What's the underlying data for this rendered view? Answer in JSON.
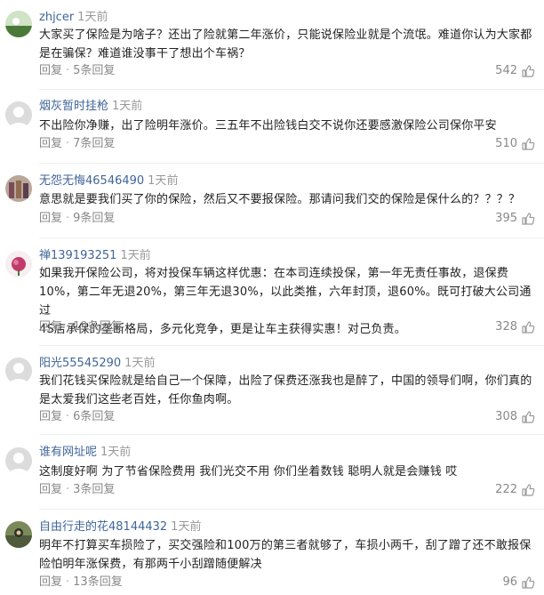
{
  "comments": [
    {
      "username": "zhjcer",
      "time": "1天前",
      "lines": [
        "大家买了保险是为啥子？还出了险就第二年涨价，只能说保险业就是个流氓。难道你认为大家都",
        "是在骗保？难道谁没事干了想出个车祸？"
      ],
      "reply_label": "回复",
      "reply_count": "5条回复",
      "likes": "542"
    },
    {
      "username": "烟灰暂时挂枪",
      "time": "1天前",
      "lines": [
        "不出险你净赚，出了险明年涨价。三五年不出险钱白交不说你还要感激保险公司保你平安"
      ],
      "reply_label": "回复",
      "reply_count": "7条回复",
      "likes": "510"
    },
    {
      "username": "无怨无悔46546490",
      "time": "1天前",
      "lines": [
        "意思就是要我们买了你的保险，然后又不要报保险。那请问我们交的保险是保什么的？？？？"
      ],
      "reply_label": "回复",
      "reply_count": "9条回复",
      "likes": "395"
    },
    {
      "username": "禅139193251",
      "time": "1天前",
      "lines": [
        "如果我开保险公司，将对投保车辆这样优惠：在本司连续投保，第一年无责任事故，退保费",
        "10%，第二年无退20%，第三年无退30%，以此类推，六年封顶，退60%。既可打破大公司通过",
        "4S店承保的垄断格局，多元化竞争，更是让车主获得实惠！对己负责。"
      ],
      "reply_label": "回复",
      "reply_count": "19条回复",
      "likes": "328"
    },
    {
      "username": "阳光55545290",
      "time": "1天前",
      "lines": [
        "我们花钱买保险就是给自己一个保障，出险了保费还涨我也是醉了，中国的领导们啊，你们真的",
        "是太爱我们这些老百姓，任你鱼肉啊。"
      ],
      "reply_label": "回复",
      "reply_count": "6条回复",
      "likes": "308"
    },
    {
      "username": "谁有网址呢",
      "time": "1天前",
      "lines": [
        "这制度好啊 为了节省保险费用 我们光交不用 你们坐着数钱 聪明人就是会赚钱 哎"
      ],
      "reply_label": "回复",
      "reply_count": "3条回复",
      "likes": "222"
    },
    {
      "username": "自由行走的花48144432",
      "time": "1天前",
      "lines": [
        "明年不打算买车损险了，买交强险和100万的第三者就够了，车损小两千，刮了蹭了还不敢报保",
        "险怕明年涨保费，有那两千小刮蹭随便解决"
      ],
      "reply_label": "回复",
      "reply_count": "13条回复",
      "likes": "96"
    }
  ],
  "separator": "·",
  "icons": {
    "like": "thumbs-up-icon",
    "avatar": "user-avatar"
  },
  "colors": {
    "username": "#406599",
    "text": "#222222",
    "muted": "#888888"
  }
}
